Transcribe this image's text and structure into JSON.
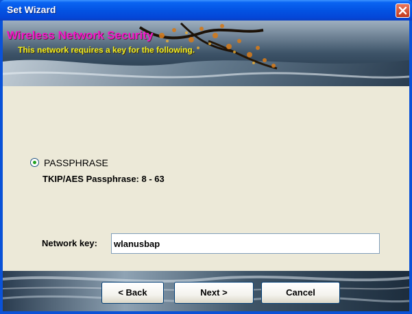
{
  "window": {
    "title": "Set Wizard",
    "close_icon": "close-icon"
  },
  "banner": {
    "title": "Wireless Network Security",
    "subtitle": "This network requires a key for the following."
  },
  "security": {
    "option_label": "PASSPHRASE",
    "option_selected": true,
    "passphrase_info": "TKIP/AES Passphrase: 8 - 63"
  },
  "network_key": {
    "label": "Network key:",
    "value": "wlanusbap"
  },
  "buttons": {
    "back": "< Back",
    "next": "Next >",
    "cancel": "Cancel"
  },
  "colors": {
    "titlebar": "#0353e3",
    "dialog_bg": "#ece9d8",
    "banner_title": "#f018c8",
    "banner_subtitle": "#f2f020",
    "close_button": "#c2391b"
  }
}
